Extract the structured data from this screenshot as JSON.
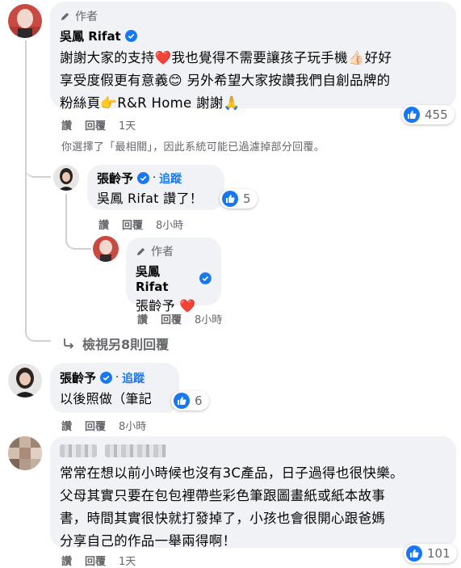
{
  "author_label": "作者",
  "comment1": {
    "name": "吳鳳 Rifat",
    "body_lines": [
      "謝謝大家的支持❤️我也覺得不需要讓孩子玩手機👍🏻好好",
      "享受度假更有意義😊 另外希望大家按讚我們自創品牌的",
      "粉絲頁👉R&R Home 謝謝🙏"
    ],
    "actions": {
      "like": "讚",
      "reply": "回覆",
      "time": "1天"
    },
    "reaction_count": "455"
  },
  "filter_notice": "你選擇了「最相關」，因此系統可能已過濾掉部分回覆。",
  "reply1": {
    "name": "張齡予",
    "follow": "追蹤",
    "dot": "·",
    "body": "吳鳳 Rifat 讚了！",
    "actions": {
      "like": "讚",
      "reply": "回覆",
      "time": "8小時"
    },
    "reaction_count": "5"
  },
  "reply2": {
    "name": "吳鳳 Rifat",
    "body": "張齡予 ❤️",
    "actions": {
      "like": "讚",
      "reply": "回覆",
      "time": "8小時"
    }
  },
  "more_replies": "檢視另8則回覆",
  "comment2": {
    "name": "張齡予",
    "follow": "追蹤",
    "dot": "·",
    "body": "以後照做（筆記",
    "actions": {
      "like": "讚",
      "reply": "回覆",
      "time": "8小時"
    },
    "reaction_count": "6"
  },
  "comment3": {
    "body_lines": [
      "常常在想以前小時候也沒有3C產品，日子過得也很快樂。",
      "父母其實只要在包包裡帶些彩色筆跟圖畫紙或紙本故事",
      "書，時間其實很快就打發￼掉了，小孩也會很開心跟爸媽",
      "分享自己的作品一舉兩得啊！"
    ],
    "actions": {
      "like": "讚",
      "reply": "回覆",
      "time": "1天"
    },
    "reaction_count": "101"
  },
  "colors": {
    "accent": "#1877f2",
    "bubble": "#f0f2f5",
    "meta": "#65676b",
    "heart": "#e41e3f"
  },
  "icons": [
    "pen-icon",
    "verified-badge-icon",
    "like-icon",
    "reply-arrow-icon"
  ]
}
